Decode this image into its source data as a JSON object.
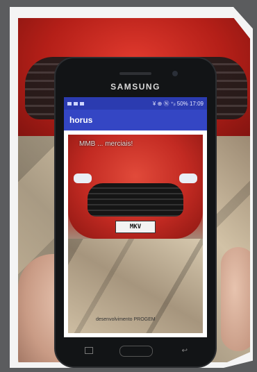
{
  "phone": {
    "brand": "SAMSUNG"
  },
  "status_bar": {
    "text": "¥ ⊕ Ⓝ ⁺ᵢₗ 50% 17:09"
  },
  "app_bar": {
    "title": "horus"
  },
  "preview": {
    "overlay_text": "MMB ... merciais!",
    "plate": "MKV",
    "footer": "desenvolvimento PROGEM"
  }
}
